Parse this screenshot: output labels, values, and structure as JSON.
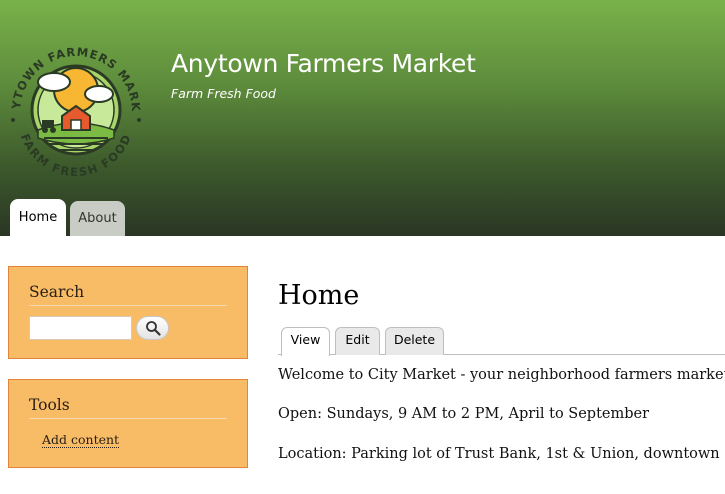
{
  "site": {
    "name": "Anytown Farmers Market",
    "slogan": "Farm Fresh Food",
    "logo_text_top": "ANYTOWN FARMERS MARKET",
    "logo_text_bottom": "FARM FRESH FOOD",
    "header_colors": [
      "#79b24a",
      "#2a3624"
    ]
  },
  "primary_tabs": [
    {
      "label": "Home",
      "active": true
    },
    {
      "label": "About",
      "active": false
    }
  ],
  "sidebar": {
    "search": {
      "title": "Search",
      "input_value": "",
      "button_icon": "search-icon"
    },
    "tools": {
      "title": "Tools",
      "links": [
        {
          "label": "Add content"
        }
      ]
    },
    "block_color": "#f8bc66"
  },
  "main": {
    "title": "Home",
    "local_tabs": [
      {
        "label": "View",
        "active": true
      },
      {
        "label": "Edit",
        "active": false
      },
      {
        "label": "Delete",
        "active": false
      }
    ],
    "paragraphs": [
      "Welcome to City Market - your neighborhood farmers market!",
      "Open: Sundays, 9 AM to 2 PM, April to September",
      "Location: Parking lot of Trust Bank, 1st & Union, downtown"
    ]
  }
}
